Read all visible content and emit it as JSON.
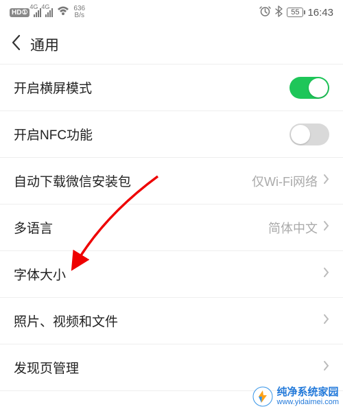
{
  "status": {
    "hd_badge": "HD①",
    "sig_label": "4G",
    "net_rate_top": "636",
    "net_rate_bottom": "B/s",
    "battery": "55",
    "time": "16:43"
  },
  "header": {
    "title": "通用"
  },
  "rows": {
    "landscape": {
      "label": "开启横屏模式",
      "on": true
    },
    "nfc": {
      "label": "开启NFC功能",
      "on": false
    },
    "autodl": {
      "label": "自动下载微信安装包",
      "value": "仅Wi-Fi网络"
    },
    "lang": {
      "label": "多语言",
      "value": "简体中文"
    },
    "font": {
      "label": "字体大小"
    },
    "media": {
      "label": "照片、视频和文件"
    },
    "discover": {
      "label": "发现页管理"
    }
  },
  "watermark": {
    "brand": "纯净系统家园",
    "url": "www.yidaimei.com"
  }
}
